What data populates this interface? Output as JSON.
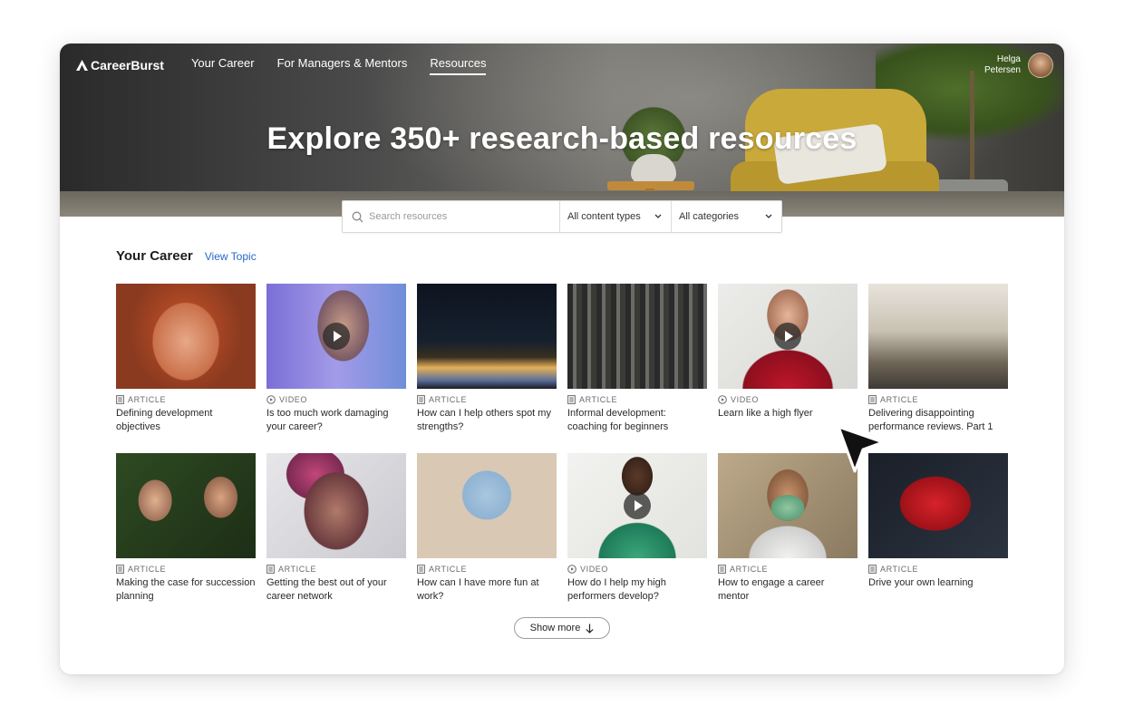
{
  "app": {
    "logo_text": "CareerBurst"
  },
  "nav": {
    "items": [
      {
        "label": "Your Career",
        "active": false
      },
      {
        "label": "For Managers & Mentors",
        "active": false
      },
      {
        "label": "Resources",
        "active": true
      }
    ]
  },
  "user": {
    "first_name": "Helga",
    "last_name": "Petersen"
  },
  "hero": {
    "title": "Explore 350+ research-based resources"
  },
  "search": {
    "placeholder": "Search resources",
    "content_type_selected": "All content types",
    "category_selected": "All categories"
  },
  "section": {
    "title": "Your Career",
    "link": "View Topic"
  },
  "cards": [
    {
      "type": "ARTICLE",
      "title": "Defining development objectives",
      "icon": "article-icon",
      "video": false
    },
    {
      "type": "VIDEO",
      "title": "Is too much work damaging your career?",
      "icon": "video-icon",
      "video": true
    },
    {
      "type": "ARTICLE",
      "title": "How can I help others spot my strengths?",
      "icon": "article-icon",
      "video": false
    },
    {
      "type": "ARTICLE",
      "title": "Informal development: coaching for beginners",
      "icon": "article-icon",
      "video": false
    },
    {
      "type": "VIDEO",
      "title": "Learn like a high flyer",
      "icon": "video-icon",
      "video": true
    },
    {
      "type": "ARTICLE",
      "title": "Delivering disappointing performance reviews. Part 1",
      "icon": "article-icon",
      "video": false
    },
    {
      "type": "ARTICLE",
      "title": "Making the case for succession planning",
      "icon": "article-icon",
      "video": false
    },
    {
      "type": "ARTICLE",
      "title": "Getting the best out of your career network",
      "icon": "article-icon",
      "video": false
    },
    {
      "type": "ARTICLE",
      "title": "How can I have more fun at work?",
      "icon": "article-icon",
      "video": false
    },
    {
      "type": "VIDEO",
      "title": "How do I help my high performers develop?",
      "icon": "video-icon",
      "video": true
    },
    {
      "type": "ARTICLE",
      "title": "How to engage a career mentor",
      "icon": "article-icon",
      "video": false
    },
    {
      "type": "ARTICLE",
      "title": "Drive your own learning",
      "icon": "article-icon",
      "video": false
    }
  ],
  "show_more": {
    "label": "Show more"
  },
  "colors": {
    "link": "#2b66c9",
    "text": "#1e1e1e",
    "muted": "#6a6a6a"
  }
}
